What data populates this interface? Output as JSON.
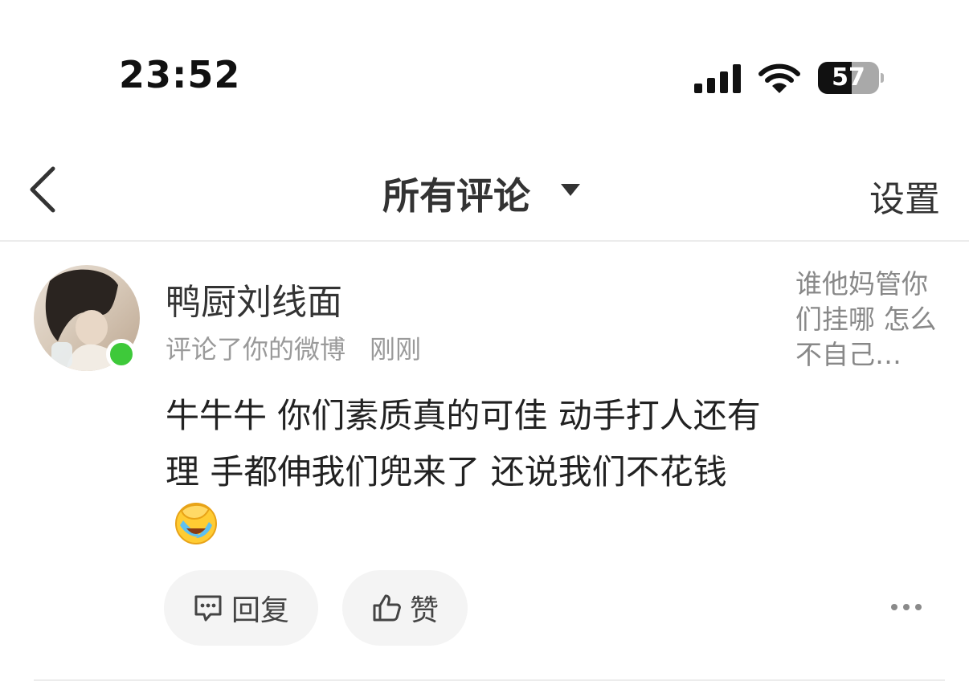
{
  "status_bar": {
    "time": "23:52",
    "battery_level": "57"
  },
  "nav": {
    "title": "所有评论",
    "settings_label": "设置"
  },
  "comment": {
    "username": "鸭厨刘线面",
    "action": "评论了你的微博",
    "time_ago": "刚刚",
    "text": "牛牛牛 你们素质真的可佳 动手打人还有理 手都伸我们兜来了 还说我们不花钱",
    "emoji": "facepalm-cry-emoji",
    "quoted_post": "谁他妈管你们挂哪 怎么不自己…",
    "reply_label": "回复",
    "like_label": "赞"
  },
  "colors": {
    "online": "#3ec93a",
    "pill_bg": "#f4f4f4",
    "meta_text": "#9a9a9a"
  }
}
